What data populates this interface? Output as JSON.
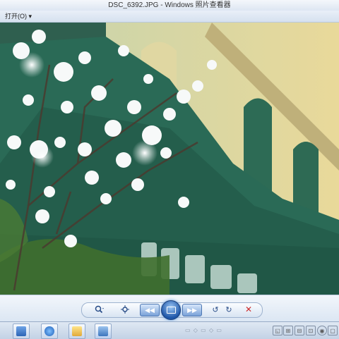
{
  "window": {
    "title": "DSC_6392.JPG - Windows 照片查看器"
  },
  "menubar": {
    "open_label": "打开(O) ▾"
  },
  "photo": {
    "description_icon": "photo-canvas"
  },
  "controls": {
    "zoom_icon": "zoom-icon",
    "fit_icon": "actual-size-icon",
    "prev_icon": "previous-icon",
    "slideshow_icon": "slideshow-icon",
    "next_icon": "next-icon",
    "rotate_ccw_icon": "rotate-counterclockwise-icon",
    "rotate_cw_icon": "rotate-clockwise-icon",
    "delete_icon": "delete-icon"
  },
  "colors": {
    "accent": "#1e56a8",
    "delete": "#cc2a2a",
    "titlebar": "#dde6f2"
  }
}
